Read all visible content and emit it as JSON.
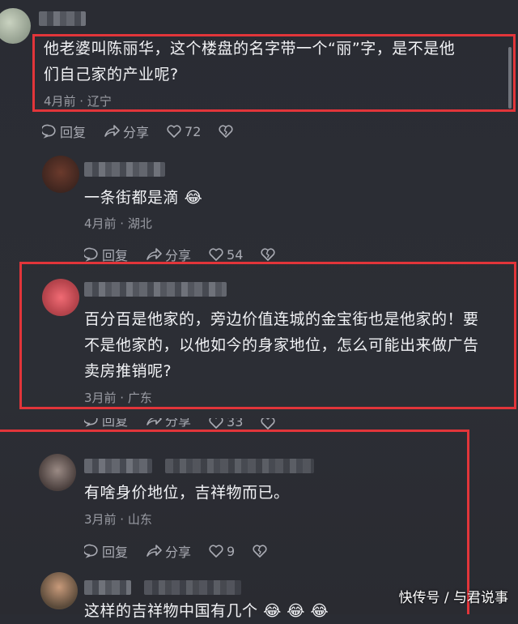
{
  "comments": [
    {
      "text_line1": "他老婆叫陈丽华，这个楼盘的名字带一个“丽”字，是不是他",
      "text_line2": "们自己家的产业呢?",
      "meta": "4月前 · 辽宁",
      "reply": "回复",
      "share": "分享",
      "likes": "72"
    },
    {
      "text": "一条街都是滴",
      "emoji": "😂",
      "meta": "4月前 · 湖北",
      "reply": "回复",
      "share": "分享",
      "likes": "54"
    },
    {
      "text_line1": "百分百是他家的，旁边价值连城的金宝街也是他家的！要",
      "text_line2": "不是他家的，以他如今的身家地位，怎么可能出来做广告",
      "text_line3": "卖房推销呢?",
      "meta": "3月前 · 广东",
      "reply": "回复",
      "share": "分享",
      "likes": "33"
    },
    {
      "text": "有啥身价地位，吉祥物而已。",
      "meta": "3月前 · 山东",
      "reply": "回复",
      "share": "分享",
      "likes": "9"
    },
    {
      "text": "这样的吉祥物中国有几个",
      "emoji": "😂 😂 😂"
    }
  ],
  "watermark": "快传号 / 与君说事",
  "colors": {
    "highlight": "#e2353a",
    "background": "#2b2d34"
  }
}
